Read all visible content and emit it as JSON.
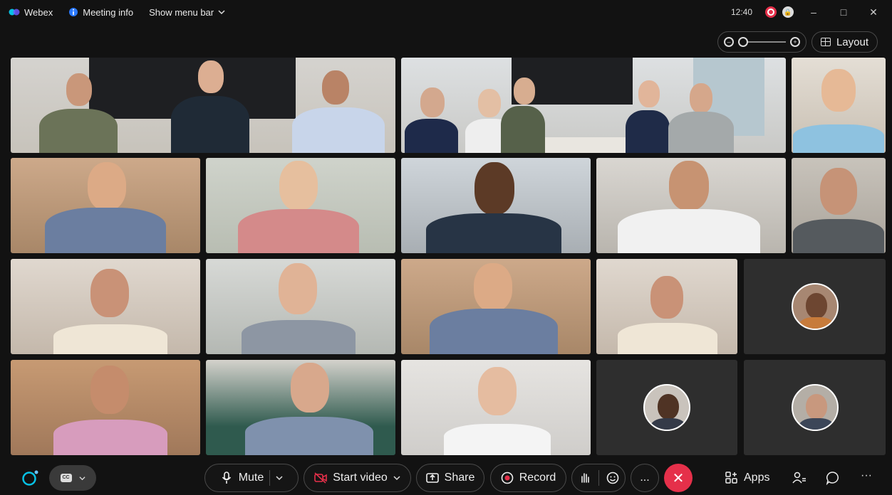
{
  "titlebar": {
    "app_name": "Webex",
    "meeting_info": "Meeting info",
    "show_menu_bar": "Show menu bar",
    "clock": "12:40"
  },
  "toolbar": {
    "layout_label": "Layout",
    "zoom_level": 0
  },
  "controls": {
    "mute_label": "Mute",
    "start_video_label": "Start video",
    "share_label": "Share",
    "record_label": "Record",
    "apps_label": "Apps",
    "more_label": "...",
    "end_label": "✕"
  },
  "colors": {
    "background": "#121212",
    "end_call": "#e5304a",
    "recording_indicator": "#e5304a",
    "webex_brand": "#07c1e4"
  },
  "icons": [
    "webex-icon",
    "meeting-info-icon",
    "chevron-down-icon",
    "recording-icon",
    "lock-icon",
    "minimize-icon",
    "maximize-icon",
    "close-icon",
    "zoom-out-icon",
    "zoom-in-icon",
    "layout-grid-icon",
    "webex-assistant-icon",
    "closed-caption-icon",
    "microphone-icon",
    "video-off-icon",
    "share-icon",
    "record-icon",
    "raise-hand-icon",
    "reactions-icon",
    "more-icon",
    "end-call-icon",
    "apps-icon",
    "participants-icon",
    "chat-icon"
  ]
}
